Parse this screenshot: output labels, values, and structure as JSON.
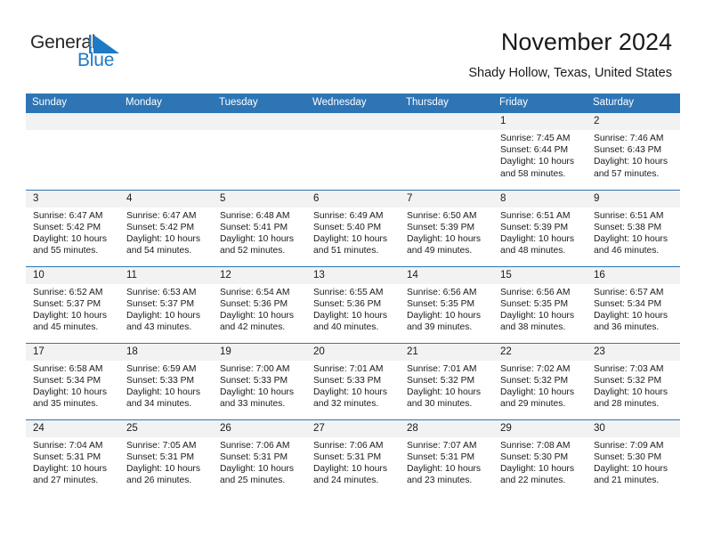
{
  "brand": {
    "name_part1": "General",
    "name_part2": "Blue",
    "accent_color": "#1f7ac4",
    "triangle_icon": "blue-triangle-icon"
  },
  "header": {
    "title": "November 2024",
    "subtitle": "Shady Hollow, Texas, United States",
    "header_bg_color": "#2e75b6",
    "daystrip_bg_color": "#f2f2f2"
  },
  "weekdays": [
    "Sunday",
    "Monday",
    "Tuesday",
    "Wednesday",
    "Thursday",
    "Friday",
    "Saturday"
  ],
  "labels": {
    "sunrise_prefix": "Sunrise:",
    "sunset_prefix": "Sunset:",
    "daylight_prefix": "Daylight:"
  },
  "weeks": [
    [
      {
        "day": "",
        "sunrise": "",
        "sunset": "",
        "daylight": ""
      },
      {
        "day": "",
        "sunrise": "",
        "sunset": "",
        "daylight": ""
      },
      {
        "day": "",
        "sunrise": "",
        "sunset": "",
        "daylight": ""
      },
      {
        "day": "",
        "sunrise": "",
        "sunset": "",
        "daylight": ""
      },
      {
        "day": "",
        "sunrise": "",
        "sunset": "",
        "daylight": ""
      },
      {
        "day": "1",
        "sunrise": "Sunrise: 7:45 AM",
        "sunset": "Sunset: 6:44 PM",
        "daylight": "Daylight: 10 hours and 58 minutes."
      },
      {
        "day": "2",
        "sunrise": "Sunrise: 7:46 AM",
        "sunset": "Sunset: 6:43 PM",
        "daylight": "Daylight: 10 hours and 57 minutes."
      }
    ],
    [
      {
        "day": "3",
        "sunrise": "Sunrise: 6:47 AM",
        "sunset": "Sunset: 5:42 PM",
        "daylight": "Daylight: 10 hours and 55 minutes."
      },
      {
        "day": "4",
        "sunrise": "Sunrise: 6:47 AM",
        "sunset": "Sunset: 5:42 PM",
        "daylight": "Daylight: 10 hours and 54 minutes."
      },
      {
        "day": "5",
        "sunrise": "Sunrise: 6:48 AM",
        "sunset": "Sunset: 5:41 PM",
        "daylight": "Daylight: 10 hours and 52 minutes."
      },
      {
        "day": "6",
        "sunrise": "Sunrise: 6:49 AM",
        "sunset": "Sunset: 5:40 PM",
        "daylight": "Daylight: 10 hours and 51 minutes."
      },
      {
        "day": "7",
        "sunrise": "Sunrise: 6:50 AM",
        "sunset": "Sunset: 5:39 PM",
        "daylight": "Daylight: 10 hours and 49 minutes."
      },
      {
        "day": "8",
        "sunrise": "Sunrise: 6:51 AM",
        "sunset": "Sunset: 5:39 PM",
        "daylight": "Daylight: 10 hours and 48 minutes."
      },
      {
        "day": "9",
        "sunrise": "Sunrise: 6:51 AM",
        "sunset": "Sunset: 5:38 PM",
        "daylight": "Daylight: 10 hours and 46 minutes."
      }
    ],
    [
      {
        "day": "10",
        "sunrise": "Sunrise: 6:52 AM",
        "sunset": "Sunset: 5:37 PM",
        "daylight": "Daylight: 10 hours and 45 minutes."
      },
      {
        "day": "11",
        "sunrise": "Sunrise: 6:53 AM",
        "sunset": "Sunset: 5:37 PM",
        "daylight": "Daylight: 10 hours and 43 minutes."
      },
      {
        "day": "12",
        "sunrise": "Sunrise: 6:54 AM",
        "sunset": "Sunset: 5:36 PM",
        "daylight": "Daylight: 10 hours and 42 minutes."
      },
      {
        "day": "13",
        "sunrise": "Sunrise: 6:55 AM",
        "sunset": "Sunset: 5:36 PM",
        "daylight": "Daylight: 10 hours and 40 minutes."
      },
      {
        "day": "14",
        "sunrise": "Sunrise: 6:56 AM",
        "sunset": "Sunset: 5:35 PM",
        "daylight": "Daylight: 10 hours and 39 minutes."
      },
      {
        "day": "15",
        "sunrise": "Sunrise: 6:56 AM",
        "sunset": "Sunset: 5:35 PM",
        "daylight": "Daylight: 10 hours and 38 minutes."
      },
      {
        "day": "16",
        "sunrise": "Sunrise: 6:57 AM",
        "sunset": "Sunset: 5:34 PM",
        "daylight": "Daylight: 10 hours and 36 minutes."
      }
    ],
    [
      {
        "day": "17",
        "sunrise": "Sunrise: 6:58 AM",
        "sunset": "Sunset: 5:34 PM",
        "daylight": "Daylight: 10 hours and 35 minutes."
      },
      {
        "day": "18",
        "sunrise": "Sunrise: 6:59 AM",
        "sunset": "Sunset: 5:33 PM",
        "daylight": "Daylight: 10 hours and 34 minutes."
      },
      {
        "day": "19",
        "sunrise": "Sunrise: 7:00 AM",
        "sunset": "Sunset: 5:33 PM",
        "daylight": "Daylight: 10 hours and 33 minutes."
      },
      {
        "day": "20",
        "sunrise": "Sunrise: 7:01 AM",
        "sunset": "Sunset: 5:33 PM",
        "daylight": "Daylight: 10 hours and 32 minutes."
      },
      {
        "day": "21",
        "sunrise": "Sunrise: 7:01 AM",
        "sunset": "Sunset: 5:32 PM",
        "daylight": "Daylight: 10 hours and 30 minutes."
      },
      {
        "day": "22",
        "sunrise": "Sunrise: 7:02 AM",
        "sunset": "Sunset: 5:32 PM",
        "daylight": "Daylight: 10 hours and 29 minutes."
      },
      {
        "day": "23",
        "sunrise": "Sunrise: 7:03 AM",
        "sunset": "Sunset: 5:32 PM",
        "daylight": "Daylight: 10 hours and 28 minutes."
      }
    ],
    [
      {
        "day": "24",
        "sunrise": "Sunrise: 7:04 AM",
        "sunset": "Sunset: 5:31 PM",
        "daylight": "Daylight: 10 hours and 27 minutes."
      },
      {
        "day": "25",
        "sunrise": "Sunrise: 7:05 AM",
        "sunset": "Sunset: 5:31 PM",
        "daylight": "Daylight: 10 hours and 26 minutes."
      },
      {
        "day": "26",
        "sunrise": "Sunrise: 7:06 AM",
        "sunset": "Sunset: 5:31 PM",
        "daylight": "Daylight: 10 hours and 25 minutes."
      },
      {
        "day": "27",
        "sunrise": "Sunrise: 7:06 AM",
        "sunset": "Sunset: 5:31 PM",
        "daylight": "Daylight: 10 hours and 24 minutes."
      },
      {
        "day": "28",
        "sunrise": "Sunrise: 7:07 AM",
        "sunset": "Sunset: 5:31 PM",
        "daylight": "Daylight: 10 hours and 23 minutes."
      },
      {
        "day": "29",
        "sunrise": "Sunrise: 7:08 AM",
        "sunset": "Sunset: 5:30 PM",
        "daylight": "Daylight: 10 hours and 22 minutes."
      },
      {
        "day": "30",
        "sunrise": "Sunrise: 7:09 AM",
        "sunset": "Sunset: 5:30 PM",
        "daylight": "Daylight: 10 hours and 21 minutes."
      }
    ]
  ]
}
